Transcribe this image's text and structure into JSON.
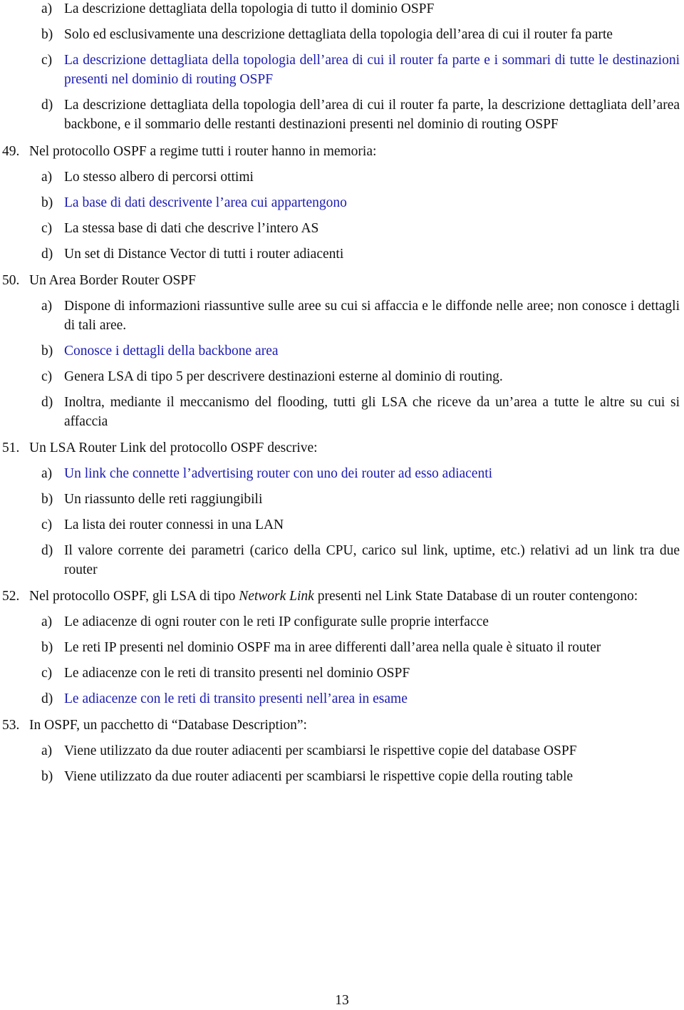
{
  "accent_color_correct_answer": "#1a1ab4",
  "continued_question": {
    "options": [
      {
        "label": "a)",
        "text": "La descrizione dettagliata della topologia di tutto il dominio OSPF",
        "correct": false
      },
      {
        "label": "b)",
        "text": "Solo ed esclusivamente una descrizione dettagliata della topologia dell’area di cui il router fa parte",
        "correct": false
      },
      {
        "label": "c)",
        "text": "La descrizione dettagliata della topologia dell’area di cui il router fa parte e i sommari di tutte le destinazioni presenti nel dominio di routing OSPF",
        "correct": true
      },
      {
        "label": "d)",
        "text": "La descrizione dettagliata della topologia dell’area di cui il router fa parte, la descrizione dettagliata dell’area backbone, e il sommario delle restanti destinazioni presenti nel dominio di routing OSPF",
        "correct": false
      }
    ]
  },
  "questions": [
    {
      "number": "49.",
      "text": "Nel protocollo OSPF a regime tutti i router hanno in memoria:",
      "options": [
        {
          "label": "a)",
          "text": "Lo stesso albero di percorsi ottimi",
          "correct": false
        },
        {
          "label": "b)",
          "text": "La base di dati descrivente l’area cui appartengono",
          "correct": true
        },
        {
          "label": "c)",
          "text": "La stessa base di dati che descrive l’intero AS",
          "correct": false
        },
        {
          "label": "d)",
          "text": "Un set di Distance Vector di tutti i router adiacenti",
          "correct": false
        }
      ]
    },
    {
      "number": "50.",
      "text": "Un Area Border Router OSPF",
      "options": [
        {
          "label": "a)",
          "text": "Dispone di informazioni riassuntive sulle aree su cui si affaccia e le diffonde nelle aree; non conosce i dettagli di tali aree.",
          "correct": false
        },
        {
          "label": "b)",
          "text": "Conosce i dettagli della backbone area",
          "correct": true
        },
        {
          "label": "c)",
          "text": "Genera LSA di tipo 5 per descrivere destinazioni esterne al dominio di routing.",
          "correct": false
        },
        {
          "label": "d)",
          "text": "Inoltra, mediante il meccanismo del flooding, tutti gli LSA che riceve da un’area a tutte le altre su cui si affaccia",
          "correct": false
        }
      ]
    },
    {
      "number": "51.",
      "text": "Un LSA Router Link del protocollo OSPF descrive:",
      "options": [
        {
          "label": "a)",
          "text": "Un link che connette l’advertising router con uno dei router ad esso adiacenti",
          "correct": true
        },
        {
          "label": "b)",
          "text": "Un riassunto delle reti raggiungibili",
          "correct": false
        },
        {
          "label": "c)",
          "text": "La lista dei router connessi in una LAN",
          "correct": false
        },
        {
          "label": "d)",
          "text": "Il valore corrente dei parametri (carico della CPU, carico sul link, uptime, etc.) relativi ad un link tra due router",
          "correct": false
        }
      ]
    },
    {
      "number": "52.",
      "text_before": "Nel protocollo OSPF, gli LSA di tipo ",
      "text_italic": "Network Link",
      "text_after": " presenti nel Link State Database di un router contengono:",
      "options": [
        {
          "label": "a)",
          "text": "Le adiacenze di ogni router con le reti IP configurate sulle proprie interfacce",
          "correct": false
        },
        {
          "label": "b)",
          "text": "Le reti IP presenti nel dominio OSPF ma in aree differenti dall’area nella quale è situato il router",
          "correct": false
        },
        {
          "label": "c)",
          "text": "Le adiacenze con le reti di transito presenti nel dominio OSPF",
          "correct": false
        },
        {
          "label": "d)",
          "text": "Le adiacenze con le reti di transito presenti nell’area in esame",
          "correct": true
        }
      ]
    },
    {
      "number": "53.",
      "text": "In OSPF, un pacchetto di “Database Description”:",
      "options": [
        {
          "label": "a)",
          "text": "Viene utilizzato da due router adiacenti per scambiarsi le rispettive copie del database OSPF",
          "correct": false
        },
        {
          "label": "b)",
          "text": "Viene utilizzato da due router adiacenti per scambiarsi le rispettive copie della routing table",
          "correct": false
        }
      ]
    }
  ],
  "page_number": "13"
}
